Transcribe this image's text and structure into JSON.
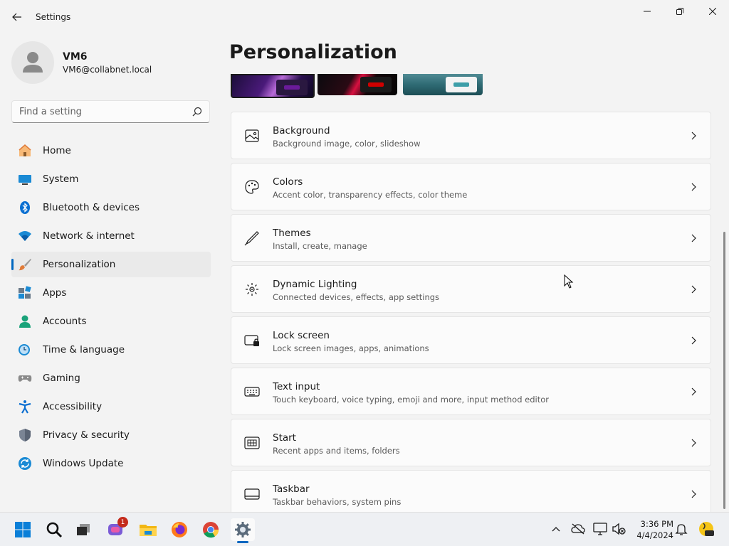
{
  "window": {
    "title": "Settings"
  },
  "profile": {
    "name": "VM6",
    "email": "VM6@collabnet.local"
  },
  "search": {
    "placeholder": "Find a setting"
  },
  "nav": {
    "items": [
      {
        "label": "Home",
        "icon": "home-icon"
      },
      {
        "label": "System",
        "icon": "system-icon"
      },
      {
        "label": "Bluetooth & devices",
        "icon": "bluetooth-icon"
      },
      {
        "label": "Network & internet",
        "icon": "wifi-icon"
      },
      {
        "label": "Personalization",
        "icon": "brush-icon",
        "active": true
      },
      {
        "label": "Apps",
        "icon": "apps-icon"
      },
      {
        "label": "Accounts",
        "icon": "accounts-icon"
      },
      {
        "label": "Time & language",
        "icon": "clock-icon"
      },
      {
        "label": "Gaming",
        "icon": "gamepad-icon"
      },
      {
        "label": "Accessibility",
        "icon": "accessibility-icon"
      },
      {
        "label": "Privacy & security",
        "icon": "shield-icon"
      },
      {
        "label": "Windows Update",
        "icon": "update-icon"
      }
    ]
  },
  "main": {
    "title": "Personalization",
    "themes": [
      {
        "chip_color": "#6a1b9a",
        "selected": true
      },
      {
        "chip_color": "#d00000",
        "selected": false
      },
      {
        "chip_color": "#3d9ea8",
        "selected": false
      }
    ],
    "cards": [
      {
        "title": "Background",
        "subtitle": "Background image, color, slideshow",
        "icon": "image-icon"
      },
      {
        "title": "Colors",
        "subtitle": "Accent color, transparency effects, color theme",
        "icon": "palette-icon"
      },
      {
        "title": "Themes",
        "subtitle": "Install, create, manage",
        "icon": "pen-icon"
      },
      {
        "title": "Dynamic Lighting",
        "subtitle": "Connected devices, effects, app settings",
        "icon": "lighting-icon"
      },
      {
        "title": "Lock screen",
        "subtitle": "Lock screen images, apps, animations",
        "icon": "lock-screen-icon"
      },
      {
        "title": "Text input",
        "subtitle": "Touch keyboard, voice typing, emoji and more, input method editor",
        "icon": "keyboard-icon"
      },
      {
        "title": "Start",
        "subtitle": "Recent apps and items, folders",
        "icon": "start-icon"
      },
      {
        "title": "Taskbar",
        "subtitle": "Taskbar behaviors, system pins",
        "icon": "taskbar-icon"
      }
    ]
  },
  "taskbar": {
    "badge_count": "1",
    "time": "3:36 PM",
    "date": "4/4/2024",
    "accent_color": "#0067c0"
  }
}
